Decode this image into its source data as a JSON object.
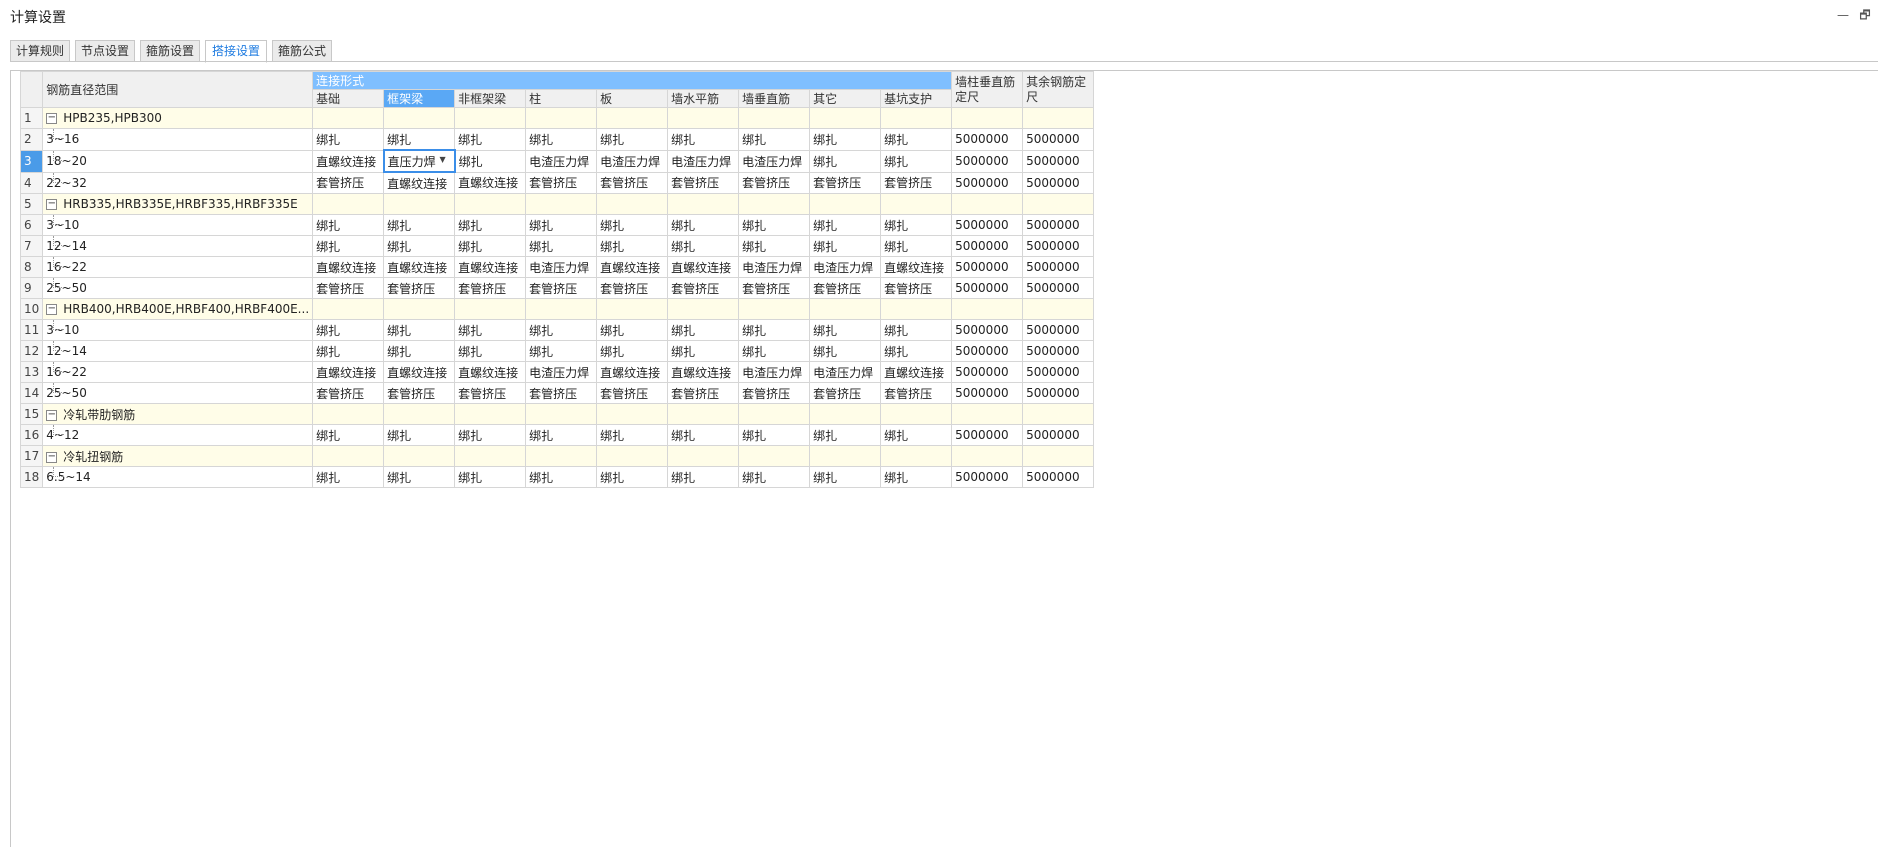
{
  "window": {
    "title": "计算设置",
    "min_label": "—",
    "restore_label": "🗗"
  },
  "tabs": [
    {
      "label": "计算规则",
      "active": false
    },
    {
      "label": "节点设置",
      "active": false
    },
    {
      "label": "箍筋设置",
      "active": false
    },
    {
      "label": "搭接设置",
      "active": true
    },
    {
      "label": "箍筋公式",
      "active": false
    }
  ],
  "table": {
    "range_header": "钢筋直径范围",
    "connection_header": "连接形式",
    "sub_headers": [
      "基础",
      "框架梁",
      "非框架梁",
      "柱",
      "板",
      "墙水平筋",
      "墙垂直筋",
      "其它",
      "基坑支护"
    ],
    "col_wall_length": "墙柱垂直筋定尺",
    "col_other_length": "其余钢筋定尺",
    "rows": [
      {
        "n": "1",
        "type": "group",
        "label": "HPB235,HPB300"
      },
      {
        "n": "2",
        "type": "item",
        "label": "3~16",
        "cells": [
          "绑扎",
          "绑扎",
          "绑扎",
          "绑扎",
          "绑扎",
          "绑扎",
          "绑扎",
          "绑扎",
          "绑扎",
          "5000000",
          "5000000"
        ]
      },
      {
        "n": "3",
        "type": "item",
        "label": "18~20",
        "cells": [
          "直螺纹连接",
          "直压力焊",
          "绑扎",
          "电渣压力焊",
          "电渣压力焊",
          "电渣压力焊",
          "电渣压力焊",
          "绑扎",
          "绑扎",
          "5000000",
          "5000000"
        ]
      },
      {
        "n": "4",
        "type": "item",
        "label": "22~32",
        "cells": [
          "套管挤压",
          "直螺纹连接",
          "直螺纹连接",
          "套管挤压",
          "套管挤压",
          "套管挤压",
          "套管挤压",
          "套管挤压",
          "套管挤压",
          "5000000",
          "5000000"
        ]
      },
      {
        "n": "5",
        "type": "group",
        "label": "HRB335,HRB335E,HRBF335,HRBF335E"
      },
      {
        "n": "6",
        "type": "item",
        "label": "3~10",
        "cells": [
          "绑扎",
          "绑扎",
          "绑扎",
          "绑扎",
          "绑扎",
          "绑扎",
          "绑扎",
          "绑扎",
          "绑扎",
          "5000000",
          "5000000"
        ]
      },
      {
        "n": "7",
        "type": "item",
        "label": "12~14",
        "cells": [
          "绑扎",
          "绑扎",
          "绑扎",
          "绑扎",
          "绑扎",
          "绑扎",
          "绑扎",
          "绑扎",
          "绑扎",
          "5000000",
          "5000000"
        ]
      },
      {
        "n": "8",
        "type": "item",
        "label": "16~22",
        "cells": [
          "直螺纹连接",
          "直螺纹连接",
          "直螺纹连接",
          "电渣压力焊",
          "直螺纹连接",
          "直螺纹连接",
          "电渣压力焊",
          "电渣压力焊",
          "直螺纹连接",
          "5000000",
          "5000000"
        ]
      },
      {
        "n": "9",
        "type": "item",
        "label": "25~50",
        "cells": [
          "套管挤压",
          "套管挤压",
          "套管挤压",
          "套管挤压",
          "套管挤压",
          "套管挤压",
          "套管挤压",
          "套管挤压",
          "套管挤压",
          "5000000",
          "5000000"
        ]
      },
      {
        "n": "10",
        "type": "group",
        "label": "HRB400,HRB400E,HRBF400,HRBF400E..."
      },
      {
        "n": "11",
        "type": "item",
        "label": "3~10",
        "cells": [
          "绑扎",
          "绑扎",
          "绑扎",
          "绑扎",
          "绑扎",
          "绑扎",
          "绑扎",
          "绑扎",
          "绑扎",
          "5000000",
          "5000000"
        ]
      },
      {
        "n": "12",
        "type": "item",
        "label": "12~14",
        "cells": [
          "绑扎",
          "绑扎",
          "绑扎",
          "绑扎",
          "绑扎",
          "绑扎",
          "绑扎",
          "绑扎",
          "绑扎",
          "5000000",
          "5000000"
        ]
      },
      {
        "n": "13",
        "type": "item",
        "label": "16~22",
        "cells": [
          "直螺纹连接",
          "直螺纹连接",
          "直螺纹连接",
          "电渣压力焊",
          "直螺纹连接",
          "直螺纹连接",
          "电渣压力焊",
          "电渣压力焊",
          "直螺纹连接",
          "5000000",
          "5000000"
        ]
      },
      {
        "n": "14",
        "type": "item",
        "label": "25~50",
        "cells": [
          "套管挤压",
          "套管挤压",
          "套管挤压",
          "套管挤压",
          "套管挤压",
          "套管挤压",
          "套管挤压",
          "套管挤压",
          "套管挤压",
          "5000000",
          "5000000"
        ]
      },
      {
        "n": "15",
        "type": "group",
        "label": "冷轧带肋钢筋"
      },
      {
        "n": "16",
        "type": "item",
        "label": "4~12",
        "cells": [
          "绑扎",
          "绑扎",
          "绑扎",
          "绑扎",
          "绑扎",
          "绑扎",
          "绑扎",
          "绑扎",
          "绑扎",
          "5000000",
          "5000000"
        ]
      },
      {
        "n": "17",
        "type": "group",
        "label": "冷轧扭钢筋"
      },
      {
        "n": "18",
        "type": "item",
        "label": "6.5~14",
        "cells": [
          "绑扎",
          "绑扎",
          "绑扎",
          "绑扎",
          "绑扎",
          "绑扎",
          "绑扎",
          "绑扎",
          "绑扎",
          "5000000",
          "5000000"
        ]
      }
    ],
    "selected_row": "3",
    "selected_col": 1,
    "toggle_symbol": "−",
    "dropdown_symbol": "▼"
  },
  "colors": {
    "header_blue": "#7fbfff",
    "selected_blue": "#4a9be8",
    "group_bg": "#fffde8",
    "active_tab": "#1e7be0"
  }
}
